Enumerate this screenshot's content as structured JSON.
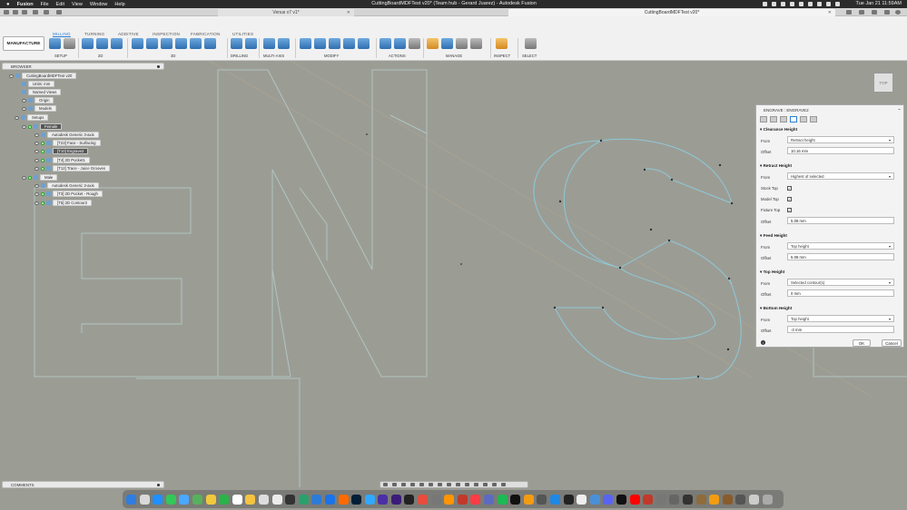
{
  "menubar": {
    "app": "Fusion",
    "items": [
      "File",
      "Edit",
      "View",
      "Window",
      "Help"
    ],
    "window_title": "CuttingBoardMDFTest v20* (Team hub - Gerard Juarez) - Autodesk Fusion",
    "clock": "Tue Jan 21  11:59AM"
  },
  "tabs": [
    {
      "label": "Venus v7 v1*"
    },
    {
      "label": "CuttingBoardMDFTest v20*"
    }
  ],
  "toolbar": {
    "workspace": "MANUFACTURE",
    "categories": [
      "MILLING",
      "TURNING",
      "ADDITIVE",
      "INSPECTION",
      "FABRICATION",
      "UTILITIES"
    ],
    "groups": [
      "SETUP",
      "2D",
      "3D",
      "DRILLING",
      "MULTI-AXIS",
      "MODIFY",
      "ACTIONS",
      "MANAGE",
      "INSPECT",
      "SELECT"
    ]
  },
  "browser": {
    "title": "BROWSER",
    "nodes": [
      {
        "label": "CuttingBoardMDFTest v20"
      },
      {
        "label": "Units: mm"
      },
      {
        "label": "Named Views"
      },
      {
        "label": "Origin"
      },
      {
        "label": "Models"
      },
      {
        "label": "Setups"
      },
      {
        "label": "Female"
      },
      {
        "label": "Autodesk Generic 3-axis"
      },
      {
        "label": "[T23] Face - Surfacing"
      },
      {
        "label": "[T10] Engrave2"
      },
      {
        "label": "[T4] 2D Pocket1"
      },
      {
        "label": "[T12] Trace - Juice Grooves"
      },
      {
        "label": "Male"
      },
      {
        "label": "Autodesk Generic 3-axis"
      },
      {
        "label": "[T3] 2D Pocket - Rough"
      },
      {
        "label": "[T5] 2D Contour2"
      }
    ]
  },
  "viewcube": {
    "label": "TOP"
  },
  "panel": {
    "title": "ENGRAVE : ENGRAVE2",
    "clearance": {
      "title": "Clearance Height",
      "from_label": "From",
      "from": "Retract height",
      "offset_label": "Offset",
      "offset": "10.16 mm"
    },
    "retract": {
      "title": "Retract Height",
      "from_label": "From",
      "from": "Highest of selected",
      "stock_top": "Stock Top",
      "model_top": "Model Top",
      "fixture_top": "Fixture Top",
      "offset_label": "Offset",
      "offset": "5.08 mm"
    },
    "feed": {
      "title": "Feed Height",
      "from_label": "From",
      "from": "Top height",
      "offset_label": "Offset",
      "offset": "5.08 mm"
    },
    "top": {
      "title": "Top Height",
      "from_label": "From",
      "from": "Selected contour(s)",
      "offset_label": "Offset",
      "offset": "0 mm"
    },
    "bottom": {
      "title": "Bottom Height",
      "from_label": "From",
      "from": "Top height",
      "offset_label": "Offset",
      "offset": "-3 mm"
    },
    "ok": "OK",
    "cancel": "Cancel",
    "info": "i"
  },
  "comments": {
    "title": "COMMENTS"
  },
  "colors": {
    "accent": "#2a7fd4",
    "canvas": "#9b9d95",
    "outline": "#8fc8d8"
  }
}
